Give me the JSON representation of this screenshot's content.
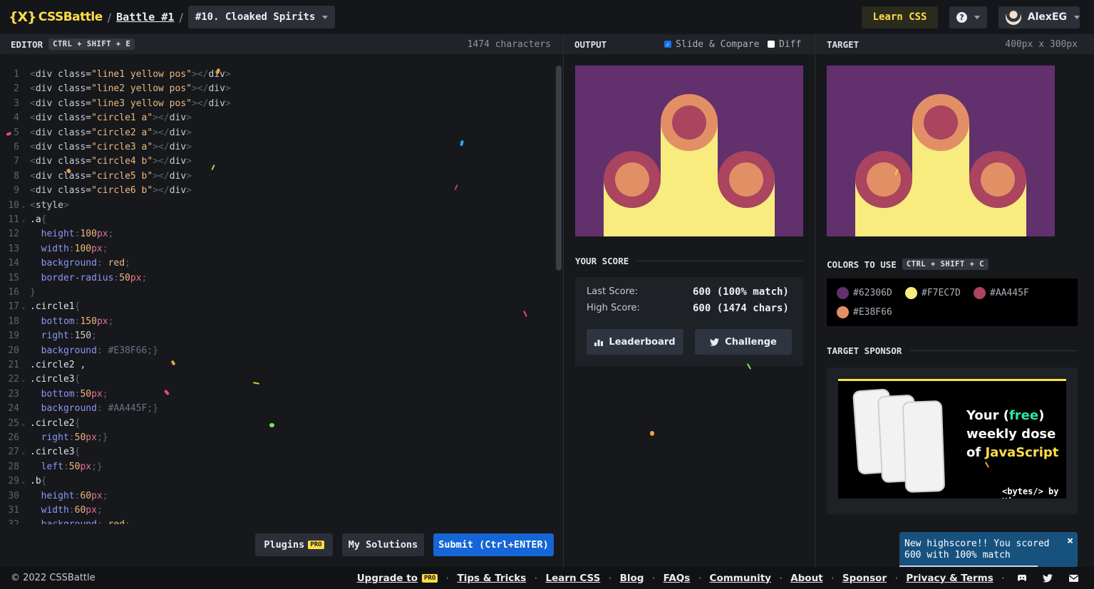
{
  "header": {
    "logo_mark": "{X}",
    "logo_text": "CSSBattle",
    "breadcrumb_sep": "/",
    "battle_link": "Battle #1",
    "target_select": "#10. Cloaked Spirits",
    "learn_label": "Learn CSS",
    "help_label": "?",
    "user_name": "AlexEG"
  },
  "editor": {
    "title": "EDITOR",
    "shortcut": "CTRL + SHIFT + E",
    "char_count": "1474 characters",
    "line_numbers": [
      "1",
      "2",
      "3",
      "4",
      "5",
      "6",
      "7",
      "8",
      "9",
      "10",
      "11",
      "12",
      "13",
      "14",
      "15",
      "16",
      "17",
      "18",
      "19",
      "20",
      "21",
      "22",
      "23",
      "24",
      "25",
      "26",
      "27",
      "28",
      "29",
      "30",
      "31",
      "32"
    ],
    "lines": [
      "<div class=\"line1 yellow pos\"></div>",
      "<div class=\"line2 yellow pos\"></div>",
      "<div class=\"line3 yellow pos\"></div>",
      "<div class=\"circle1 a\"></div>",
      "<div class=\"circle2 a\"></div>",
      "<div class=\"circle3 a\"></div>",
      "<div class=\"circle4 b\"></div>",
      "<div class=\"circle5 b\"></div>",
      "<div class=\"circle6 b\"></div>",
      "<style>",
      ".a{",
      "  height:100px;",
      "  width:100px;",
      "  background: red;",
      "  border-radius:50px;",
      "}",
      ".circle1{",
      "  bottom:150px;",
      "  right:150;",
      "  background: #E38F66;}",
      ".circle2 ,",
      ".circle3{",
      "  bottom:50px;",
      "  background: #AA445F;}",
      ".circle2{",
      "  right:50px;}",
      ".circle3{",
      "  left:50px;}",
      ".b{",
      "  height:60px;",
      "  width:60px;",
      "  background: red;"
    ],
    "buttons": {
      "plugins": "Plugins",
      "pro_badge": "PRO",
      "solutions": "My Solutions",
      "submit": "Submit (Ctrl+ENTER)"
    }
  },
  "output": {
    "title": "OUTPUT",
    "slide_compare": "Slide & Compare",
    "diff": "Diff",
    "slide_checked": true,
    "diff_checked": false
  },
  "target": {
    "title": "TARGET",
    "dims": "400px x 300px"
  },
  "score": {
    "title": "YOUR SCORE",
    "last_label": "Last Score:",
    "last_value": "600 (100% match)",
    "high_label": "High Score:",
    "high_value": "600 (1474 chars)",
    "leaderboard": "Leaderboard",
    "challenge": "Challenge"
  },
  "colors": {
    "title": "COLORS TO USE",
    "shortcut": "CTRL + SHIFT + C",
    "items": [
      {
        "label": "#62306D",
        "hex": "#62306d"
      },
      {
        "label": "#F7EC7D",
        "hex": "#f7ec7d"
      },
      {
        "label": "#AA445F",
        "hex": "#aa445f"
      },
      {
        "label": "#E38F66",
        "hex": "#e38f66"
      }
    ]
  },
  "sponsor": {
    "title": "TARGET SPONSOR",
    "line1_a": "Your (",
    "line1_b": "free",
    "line1_c": ")",
    "line2": "weekly dose",
    "line3_a": "of ",
    "line3_b": "JavaScript",
    "brand": "<bytes/> by Ui"
  },
  "toast": {
    "message_line1": "New highscore!! You scored",
    "message_line2": "600 with 100% match",
    "close": "×"
  },
  "footer": {
    "copyright": "© 2022 CSSBattle",
    "upgrade": "Upgrade to",
    "pro_badge": "PRO",
    "links": [
      "Tips & Tricks",
      "Learn CSS",
      "Blog",
      "FAQs",
      "Community",
      "About",
      "Sponsor",
      "Privacy & Terms"
    ],
    "separator": "·"
  },
  "theme": {
    "accent_yellow": "#ffde47",
    "submit_blue": "#1566d6",
    "toast_blue": "#17527f"
  }
}
